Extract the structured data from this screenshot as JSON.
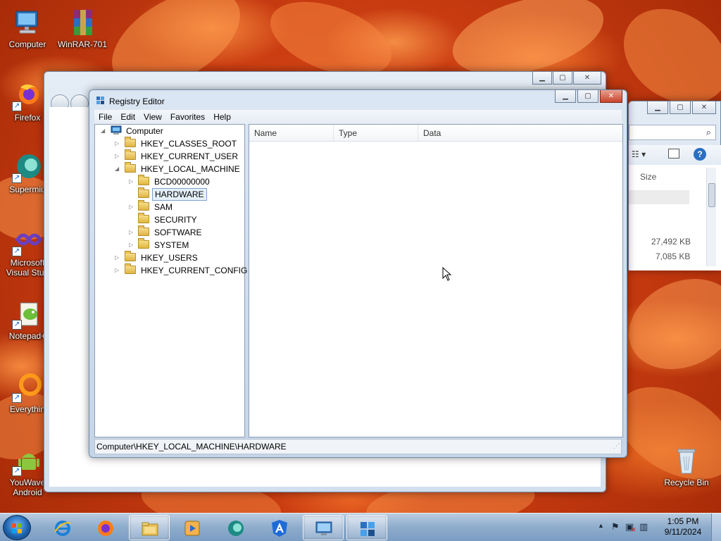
{
  "desktop": {
    "icons": [
      {
        "label": "Computer"
      },
      {
        "label": "WinRAR-701"
      },
      {
        "label": "Firefox"
      },
      {
        "label": "Supermium"
      },
      {
        "label": "Microsoft Visual Studio"
      },
      {
        "label": "Notepad++"
      },
      {
        "label": "Everything"
      },
      {
        "label": "YouWave Android"
      },
      {
        "label": "Recycle Bin"
      }
    ],
    "icon_labels_visible": {
      "supermium": "Supermiu",
      "vs_line1": "Microsoft",
      "vs_line2": "Visual Stud",
      "notepad": "Notepad+",
      "everything": "Everythin",
      "youwave_line1": "YouWave",
      "youwave_line2": "Android"
    }
  },
  "regedit": {
    "title": "Registry Editor",
    "menu": [
      "File",
      "Edit",
      "View",
      "Favorites",
      "Help"
    ],
    "tree": {
      "root": "Computer",
      "hives": [
        "HKEY_CLASSES_ROOT",
        "HKEY_CURRENT_USER",
        "HKEY_LOCAL_MACHINE",
        "HKEY_USERS",
        "HKEY_CURRENT_CONFIG"
      ],
      "hklm_children": [
        "BCD00000000",
        "HARDWARE",
        "SAM",
        "SECURITY",
        "SOFTWARE",
        "SYSTEM"
      ],
      "selected": "HARDWARE"
    },
    "columns": [
      "Name",
      "Type",
      "Data"
    ],
    "status_path": "Computer\\HKEY_LOCAL_MACHINE\\HARDWARE"
  },
  "background_window": {
    "column_size": "Size",
    "sizes": [
      "27,492 KB",
      "7,085 KB"
    ]
  },
  "taskbar": {
    "clock_time": "1:05 PM",
    "clock_date": "9/11/2024"
  },
  "colors": {
    "wallpaper": "#d8461a",
    "accent": "#1c5fa8"
  }
}
